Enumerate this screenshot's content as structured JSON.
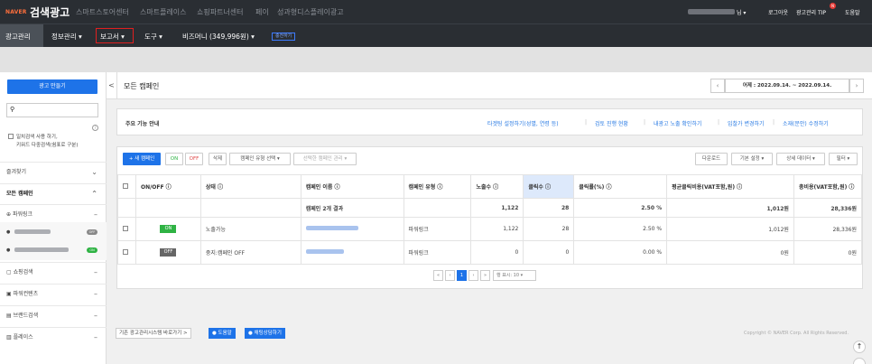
{
  "topbar": {
    "logo_naver": "NAVER",
    "logo_title": "검색광고",
    "nav": [
      "스마트스토어센터",
      "스마트플레이스",
      "쇼핑파트너센터",
      "페이",
      "성과형디스플레이광고"
    ],
    "user_suffix": "님 ▾",
    "logout": "로그아웃",
    "tip": "광고관리 TIP",
    "tip_badge": "N",
    "help": "도움말"
  },
  "subnav": {
    "items": [
      "광고관리",
      "정보관리 ▾",
      "보고서 ▾",
      "도구 ▾",
      "비즈머니 (349,996원) ▾"
    ],
    "charge": "충전하기"
  },
  "sidebar": {
    "create_btn": "광고 만들기",
    "search_placeholder": "",
    "exact_line1": "일치검색 사용 하기,",
    "exact_line2": "키워드 다중검색(쉼표로 구분)",
    "favorites": "즐겨찾기",
    "all_campaigns": "모든 캠페인",
    "groups": [
      "파워링크",
      "쇼핑검색",
      "파워컨텐츠",
      "브랜드검색",
      "플레이스"
    ],
    "toggle_off": "OFF",
    "toggle_on": "ON"
  },
  "header": {
    "back": "<",
    "title": "모든 캠페인",
    "date_label": "어제 : 2022.09.14. ~ 2022.09.14."
  },
  "guide": {
    "label": "주요 기능 안내",
    "links": [
      "타겟팅 설정하기(성별, 연령 등)",
      "검토 진행 현황",
      "내광고 노출 확인하기",
      "입찰가 변경하기",
      "소재(문안) 수정하기"
    ]
  },
  "toolbar": {
    "new_campaign": "+ 새 캠페인",
    "on": "ON",
    "off": "OFF",
    "delete": "삭제",
    "type_select": "캠페인 유형 선택 ▾",
    "selected_manage": "선택한 캠페인 관리 ▾",
    "download": "다운로드",
    "default_setting": "기본 설정 ▾",
    "detail_data": "상세 데이터 ▾",
    "filter": "필터 ▾"
  },
  "table": {
    "columns": [
      "ON/OFF ⓘ",
      "상태 ⓘ",
      "캠페인 이름 ⓘ",
      "캠페인 유형 ⓘ",
      "노출수 ⓘ",
      "클릭수 ⓘ",
      "클릭률(%) ⓘ",
      "평균클릭비용(VAT포함,원) ⓘ",
      "총비용(VAT포함,원) ⓘ"
    ],
    "summary": {
      "name": "캠페인 2개 결과",
      "impressions": "1,122",
      "clicks": "28",
      "ctr": "2.50 %",
      "cpc": "1,012원",
      "cost": "28,336원"
    },
    "rows": [
      {
        "toggle": "ON",
        "status": "노출가능",
        "type": "파워링크",
        "impressions": "1,122",
        "clicks": "28",
        "ctr": "2.50 %",
        "cpc": "1,012원",
        "cost": "28,336원"
      },
      {
        "toggle": "OFF",
        "status": "중지:캠페인 OFF",
        "type": "파워링크",
        "impressions": "0",
        "clicks": "0",
        "ctr": "0.00 %",
        "cpc": "0원",
        "cost": "0원"
      }
    ]
  },
  "pagination": {
    "first": "«",
    "prev": "‹",
    "current": "1",
    "next": "›",
    "last": "»",
    "per_page": "행 표시: 10 ▾"
  },
  "footer": {
    "legacy": "기존 광고관리시스템 바로가기 >",
    "help": "● 도움말",
    "chat": "● 채팅상담하기",
    "copyright": "Copyright © NAVER Corp. All Rights Reserved.",
    "scroll_top": "↑"
  },
  "colors": {
    "accent": "#1e73e8",
    "topbar": "#2a2e33",
    "on": "#2fb344",
    "off": "#777777",
    "highlight": "#dde9fb",
    "red_box": "#e02020"
  }
}
